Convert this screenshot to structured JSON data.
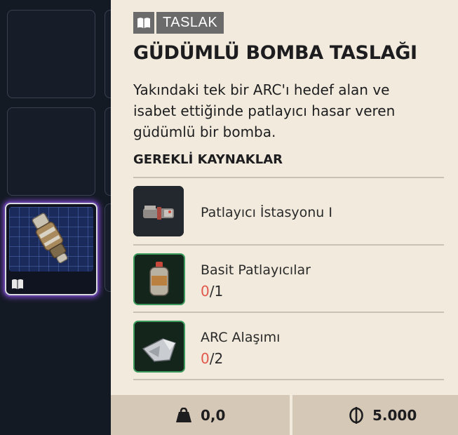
{
  "badge": {
    "icon": "book-icon",
    "label": "TASLAK"
  },
  "title": "GÜDÜMLÜ BOMBA TASLAĞI",
  "description": "Yakındaki tek bir ARC'ı hedef alan ve isabet ettiğinde patlayıcı hasar veren güdümlü bir bomba.",
  "requirements_heading": "GEREKLİ KAYNAKLAR",
  "requirements": [
    {
      "name": "Patlayıcı İstasyonu I",
      "icon": "station-icon"
    },
    {
      "name": "Basit Patlayıcılar",
      "have": "0",
      "need": "/1",
      "icon": "explosive-bottle-icon"
    },
    {
      "name": "ARC Alaşımı",
      "have": "0",
      "need": "/2",
      "icon": "arc-alloy-icon"
    }
  ],
  "footer": {
    "weight": {
      "icon": "weight-icon",
      "value": "0,0"
    },
    "price": {
      "icon": "coin-icon",
      "value": "5.000"
    }
  },
  "colors": {
    "panel": "#f2ebdd",
    "footer": "#d5c8b6",
    "badge": "#6b6b6b",
    "missing": "#e0584b",
    "rarity_frame": "#3b9a5c",
    "selection_glow": "#7a46c9"
  }
}
